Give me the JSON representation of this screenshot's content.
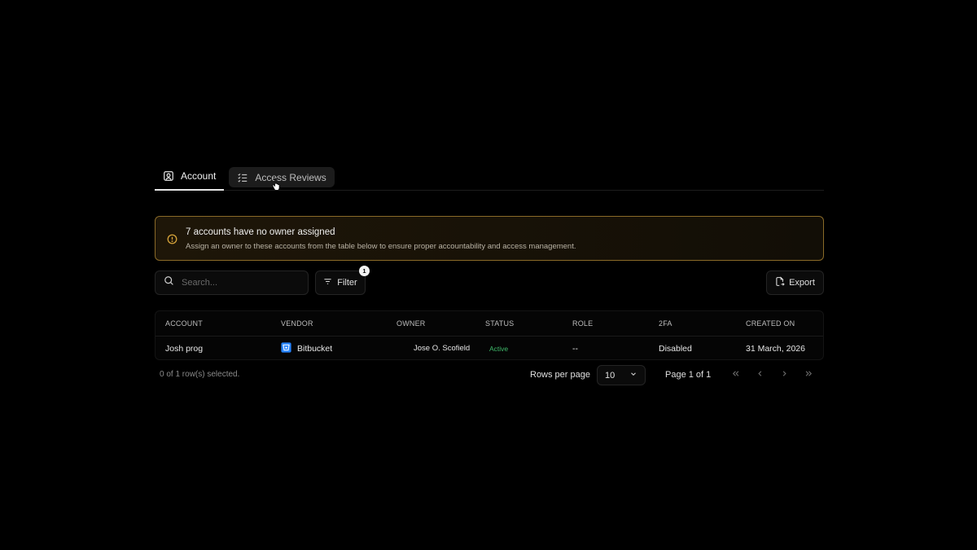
{
  "tabs": [
    {
      "label": "Account",
      "icon": "user-square-icon",
      "active": true
    },
    {
      "label": "Access Reviews",
      "icon": "list-checks-icon",
      "active": false
    }
  ],
  "alert": {
    "title": "7 accounts have no owner assigned",
    "description": "Assign an owner to these accounts from the table below to ensure proper accountability and access management.",
    "icon": "alert-circle-icon",
    "accent": "#d4a23a"
  },
  "toolbar": {
    "search_placeholder": "Search...",
    "filter_label": "Filter",
    "filter_count": "1",
    "export_label": "Export"
  },
  "table": {
    "headers": {
      "account": "ACCOUNT",
      "vendor": "VENDOR",
      "owner": "OWNER",
      "status": "STATUS",
      "role": "ROLE",
      "twofa": "2FA",
      "created": "CREATED ON"
    },
    "rows": [
      {
        "account": "Josh prog",
        "vendor": "Bitbucket",
        "vendor_icon": "bitbucket-icon",
        "owner": "Jose O. Scofield",
        "status": "Active",
        "role": "--",
        "twofa": "Disabled",
        "created": "31 March, 2026"
      }
    ]
  },
  "footer": {
    "selected": "0 of 1 row(s) selected.",
    "rows_per_page_label": "Rows per page",
    "rows_per_page_value": "10",
    "page_label": "Page 1 of 1"
  },
  "colors": {
    "background": "#000000",
    "status_active": "#3fb96a",
    "bitbucket": "#2684ff"
  }
}
